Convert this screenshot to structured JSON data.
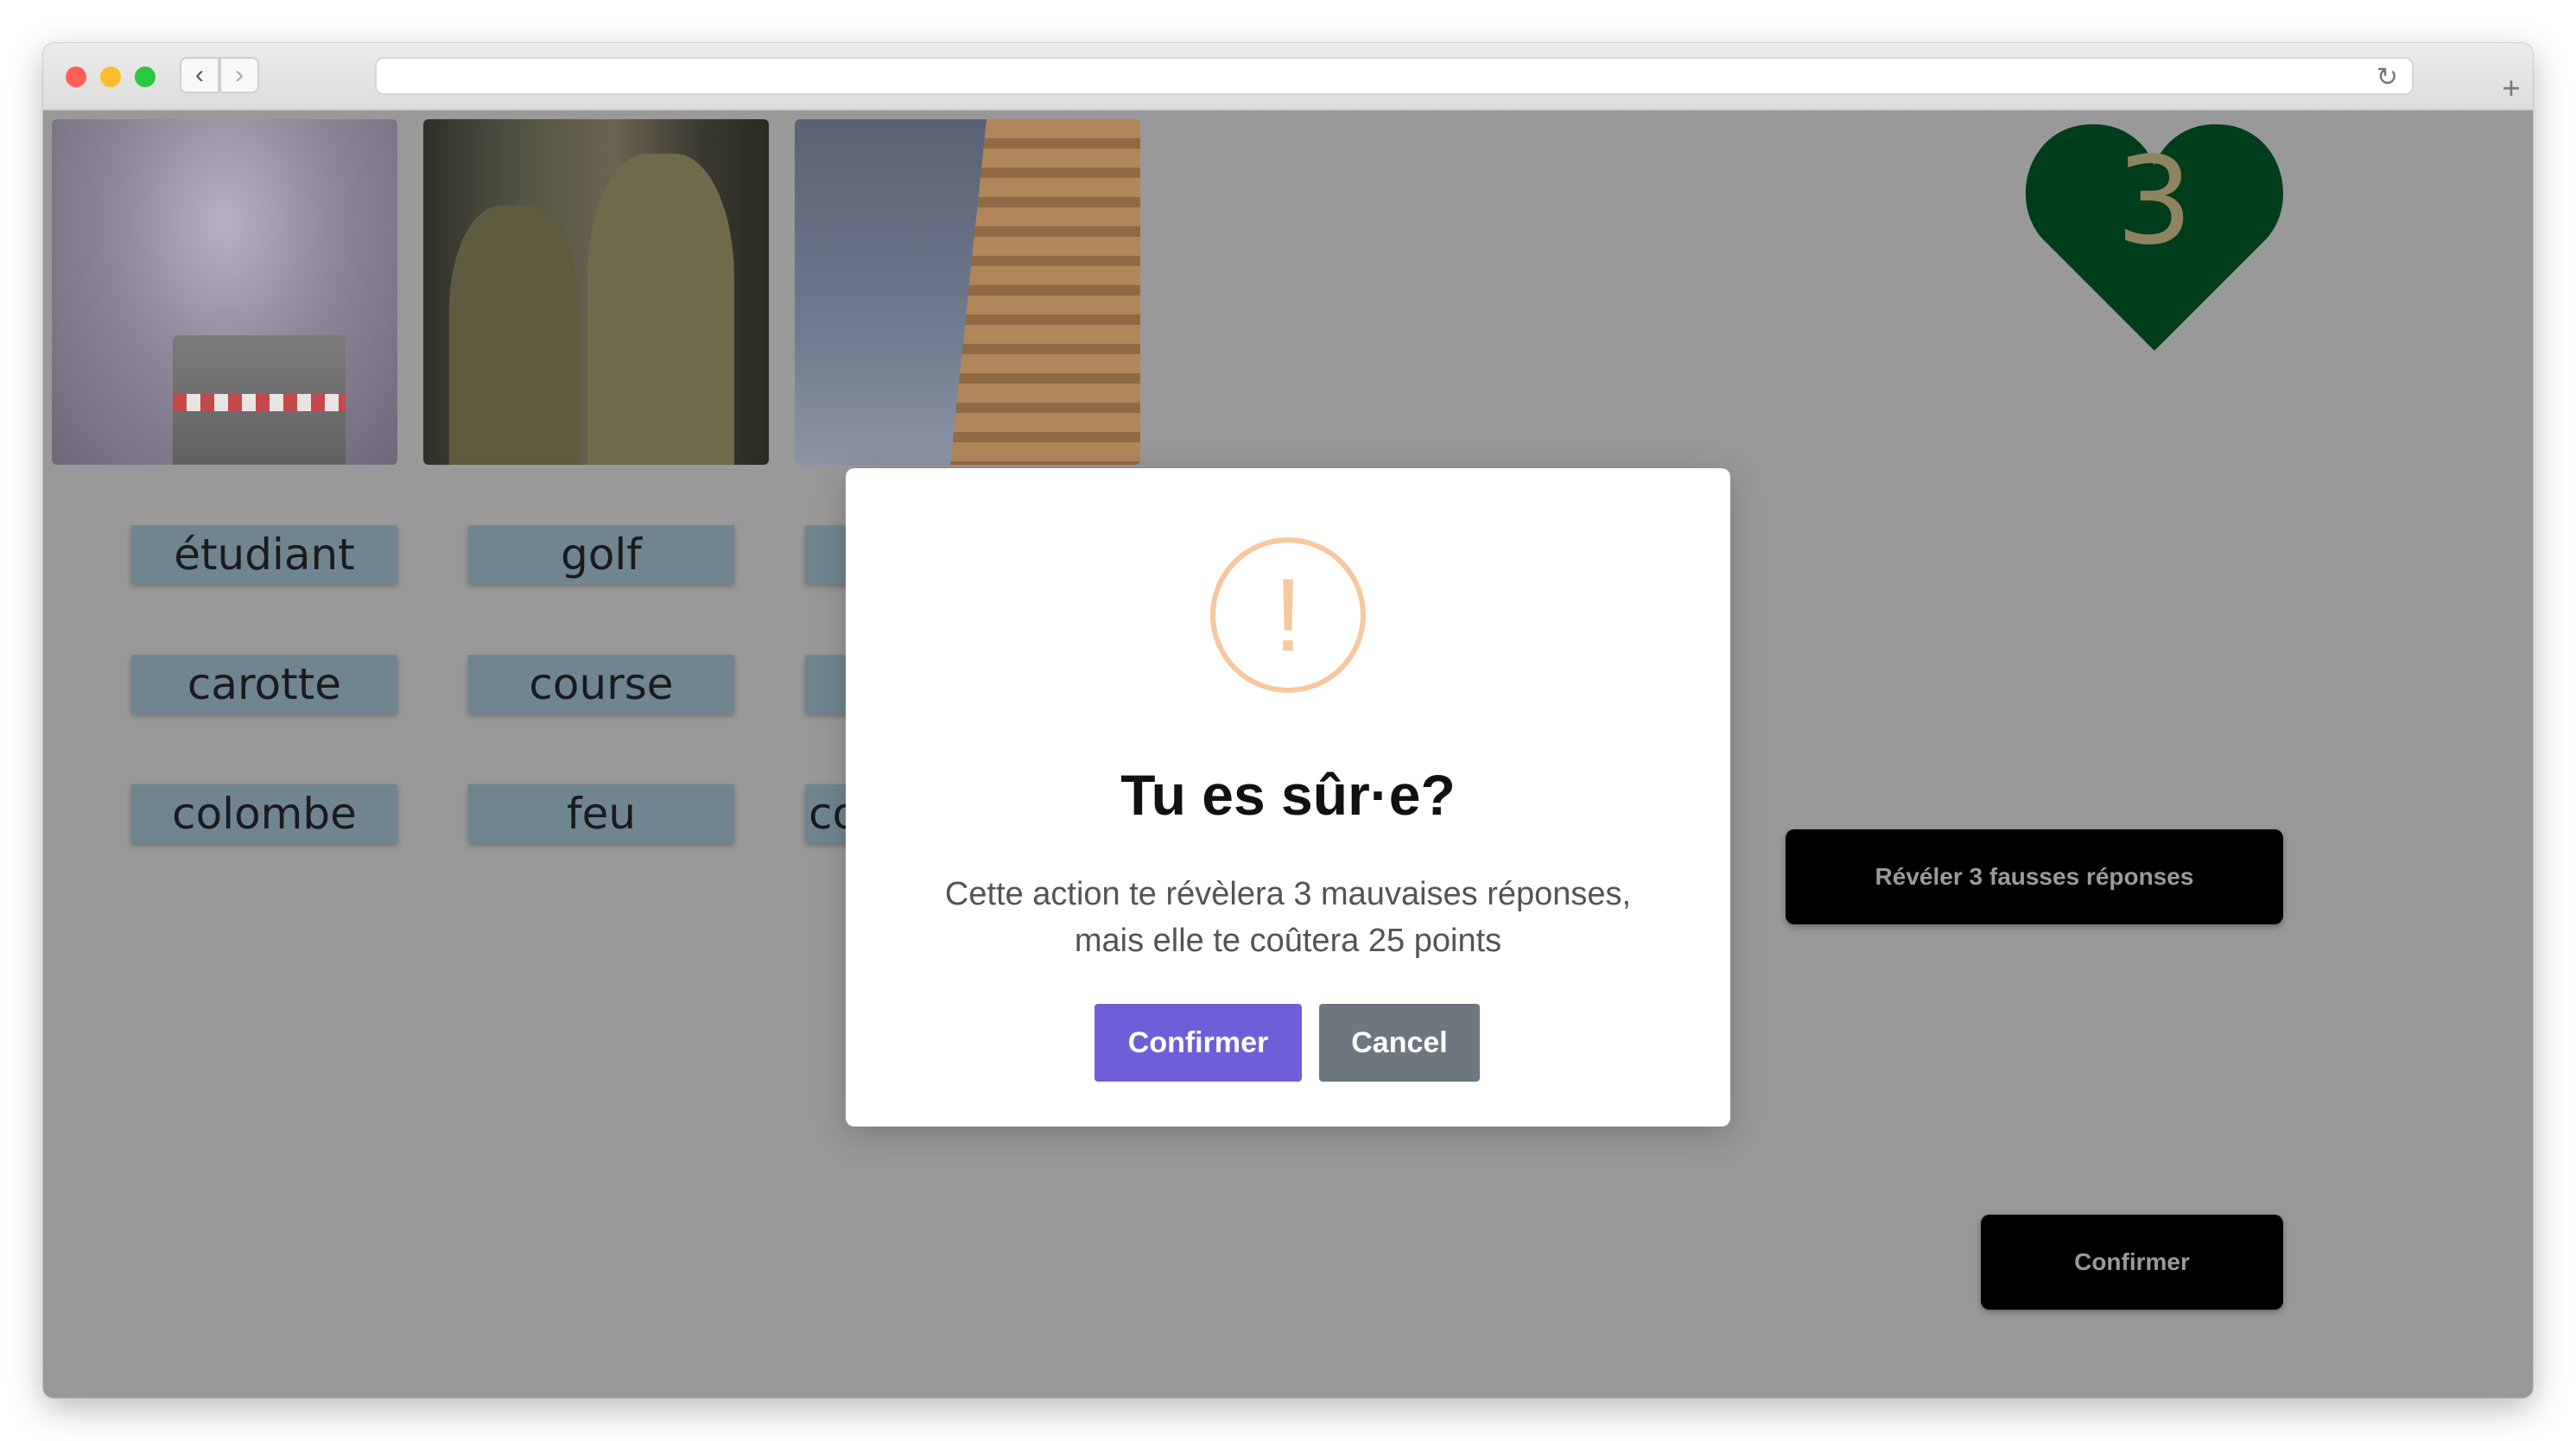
{
  "browser": {
    "nav_back": "‹",
    "nav_forward": "›",
    "reload_icon": "↻",
    "new_tab_icon": "+"
  },
  "images": [
    {
      "name": "smokestack-image"
    },
    {
      "name": "soldiers-image"
    },
    {
      "name": "leaning-tower-image"
    }
  ],
  "words": {
    "col1": [
      "étudiant",
      "carotte",
      "colombe"
    ],
    "col2": [
      "golf",
      "course",
      "feu"
    ],
    "col3_partial": [
      "",
      "",
      "co"
    ]
  },
  "lives": {
    "count": "3",
    "color": "#003d1a"
  },
  "actions": {
    "reveal_label": "Révéler 3 fausses réponses",
    "confirm_label": "Confirmer"
  },
  "dialog": {
    "icon": "!",
    "title": "Tu es sûr·e?",
    "message_line1": "Cette action te révèlera 3 mauvaises réponses,",
    "message_line2": "mais elle te coûtera 25 points",
    "confirm_label": "Confirmer",
    "cancel_label": "Cancel",
    "confirm_color": "#6e5fd9",
    "cancel_color": "#6c7780",
    "warning_color": "#f8c79d"
  }
}
